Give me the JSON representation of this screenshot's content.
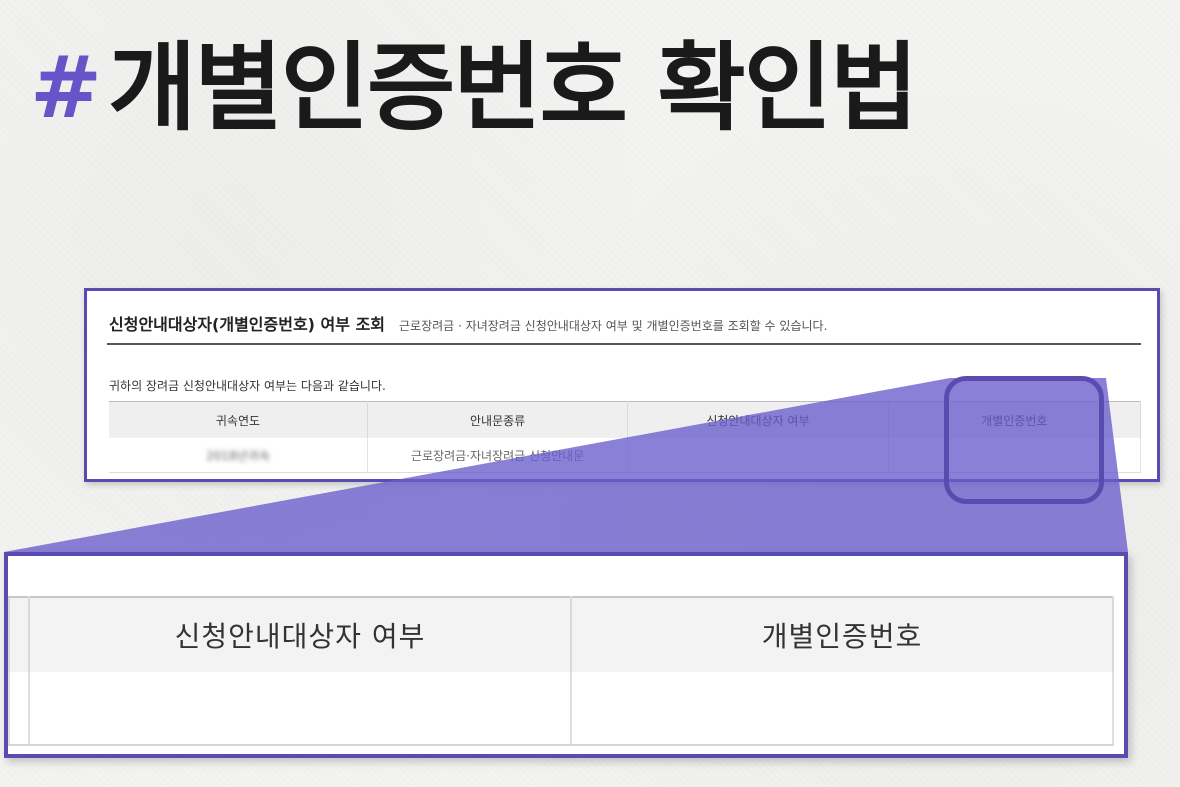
{
  "headline": {
    "hash": "#",
    "text": "개별인증번호 확인법"
  },
  "colors": {
    "accent": "#5a4bb0",
    "hash": "#6655c8",
    "beam": "#6a5ccc"
  },
  "card": {
    "title": "신청안내대상자(개별인증번호) 여부 조회",
    "description": "근로장려금 · 자녀장려금 신청안내대상자 여부 및 개별인증번호를 조회할 수 있습니다.",
    "subtitle": "귀하의 장려금 신청안내대상자 여부는 다음과 같습니다.",
    "columns": [
      "귀속연도",
      "안내문종류",
      "신청안내대상자 여부",
      "개별인증번호"
    ],
    "row": {
      "year": "2018년귀속",
      "notice_type": "근로장려금·자녀장려금 신청안내문",
      "eligibility": "",
      "auth_number": ""
    }
  },
  "zoom": {
    "columns": [
      "신청안내대상자 여부",
      "개별인증번호"
    ],
    "row": [
      "",
      ""
    ]
  }
}
